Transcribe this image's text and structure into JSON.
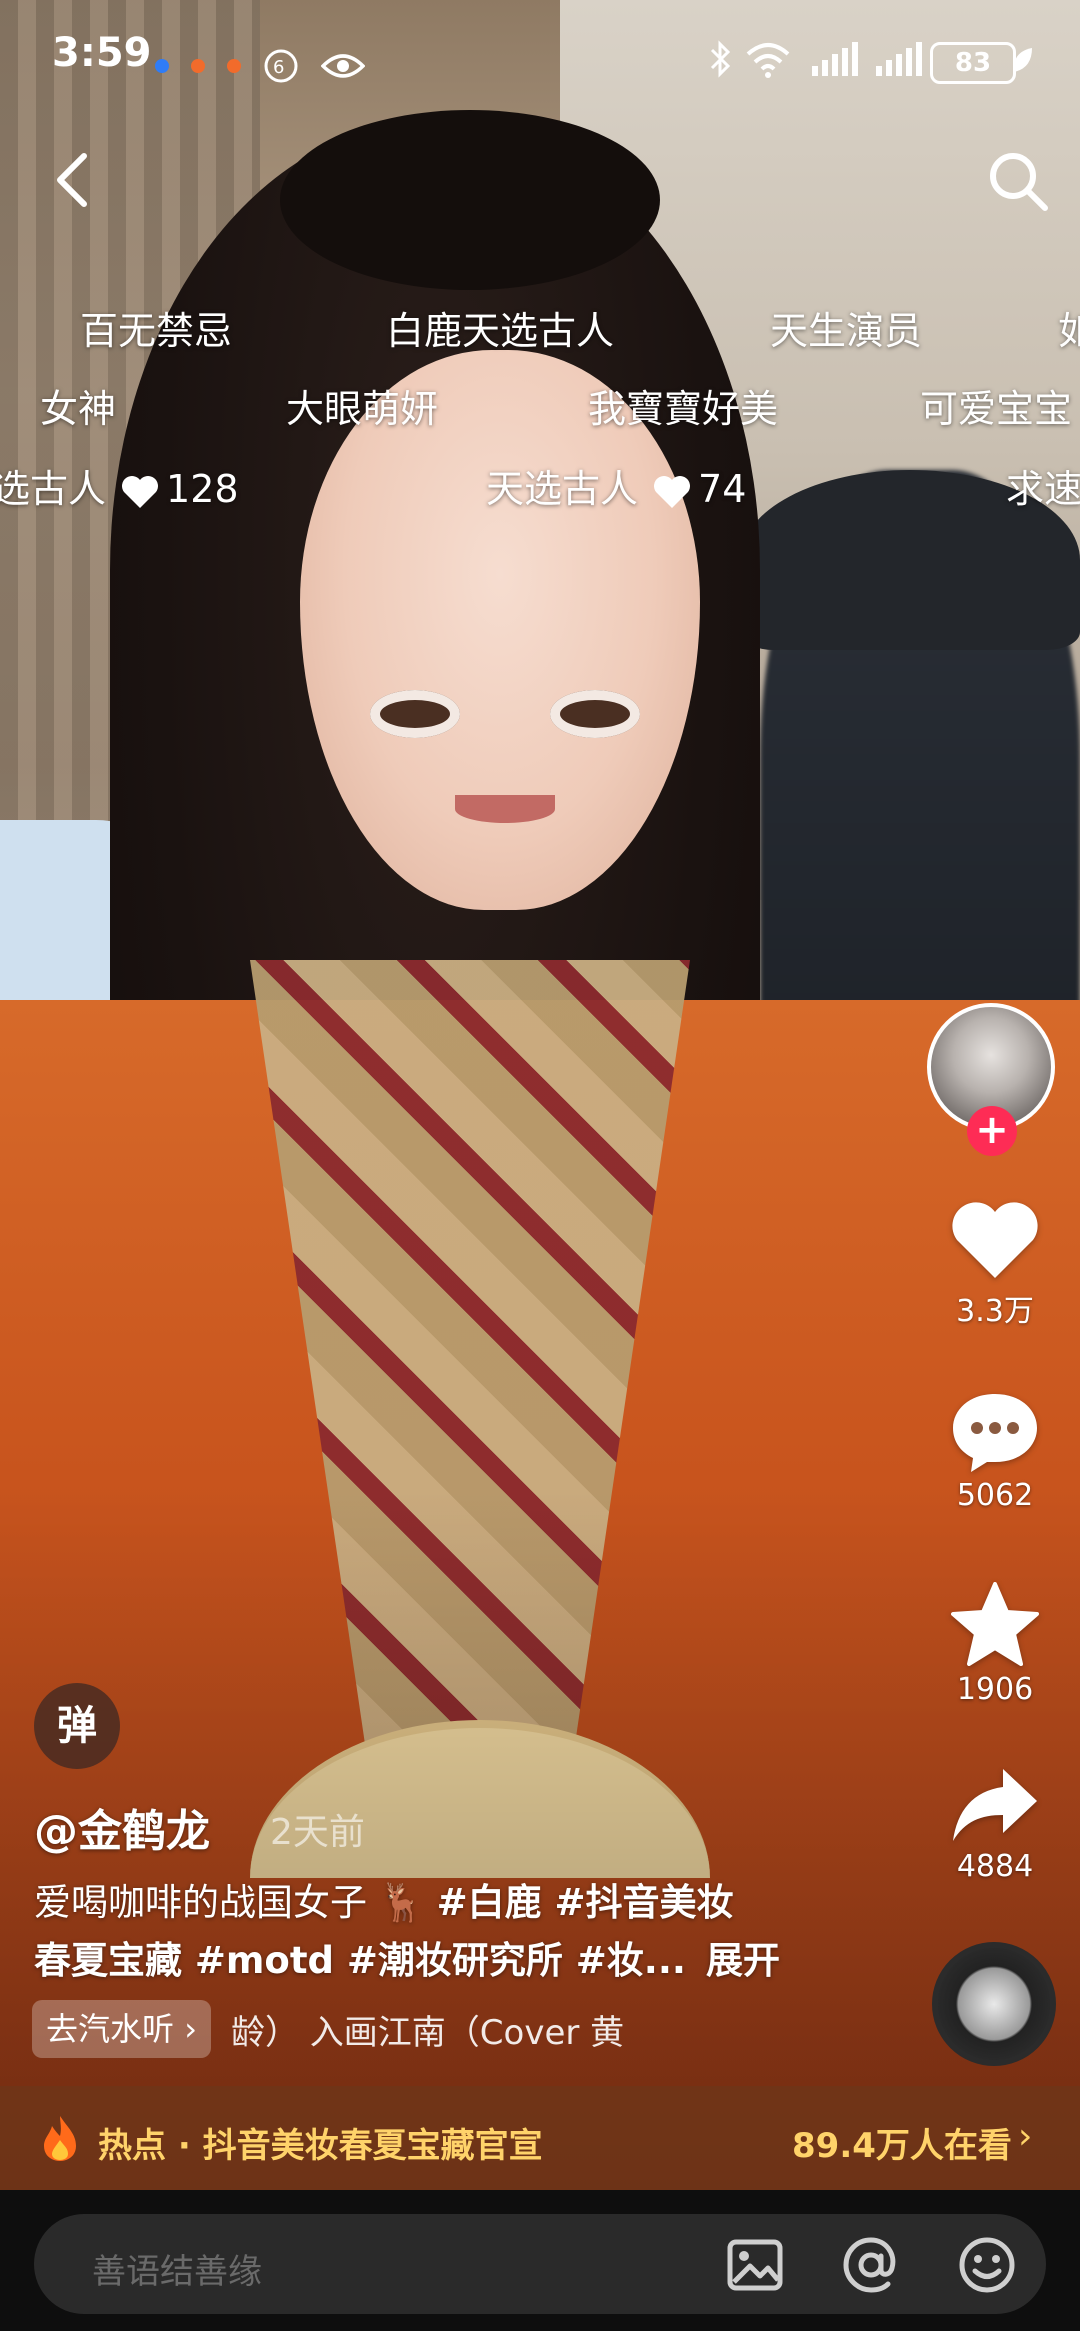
{
  "status_bar": {
    "time": "3:59",
    "battery": "83",
    "notif_colors": [
      "#2f7cf6",
      "#f26b2b",
      "#f26b2b"
    ]
  },
  "nav": {
    "back_icon": "chevron-left-icon",
    "search_icon": "search-icon"
  },
  "danmaku": [
    {
      "text": "百无禁忌"
    },
    {
      "text": "白鹿天选古人"
    },
    {
      "text": "天生演员"
    },
    {
      "text": "如"
    },
    {
      "text": "女神"
    },
    {
      "text": "大眼萌妍"
    },
    {
      "text": "我寶寶好美"
    },
    {
      "text": "可爱宝宝"
    },
    {
      "text": "选古人",
      "likes": "128"
    },
    {
      "text": "天选古人",
      "likes": "74"
    },
    {
      "text": "求速"
    }
  ],
  "actions": {
    "likes": "3.3万",
    "comments": "5062",
    "favorites": "1906",
    "shares": "4884"
  },
  "post": {
    "danmu_toggle": "弹",
    "author": "@金鹤龙",
    "time_ago": "2天前",
    "desc_line1_prefix": "爱喝咖啡的战国女子",
    "desc_line1_tags": "#白鹿 #抖音美妆",
    "desc_line2_text": "春夏宝藏 #motd #潮妆研究所 #妆...",
    "expand_label": "展开",
    "music_chip": "去汽水听",
    "music_title": "龄） 入画江南（Cover 黄"
  },
  "hot": {
    "label": "热点 · 抖音美妆春夏宝藏官宣",
    "viewers": "89.4万人在看"
  },
  "bottom_bar": {
    "comment_placeholder": "善语结善缘"
  }
}
